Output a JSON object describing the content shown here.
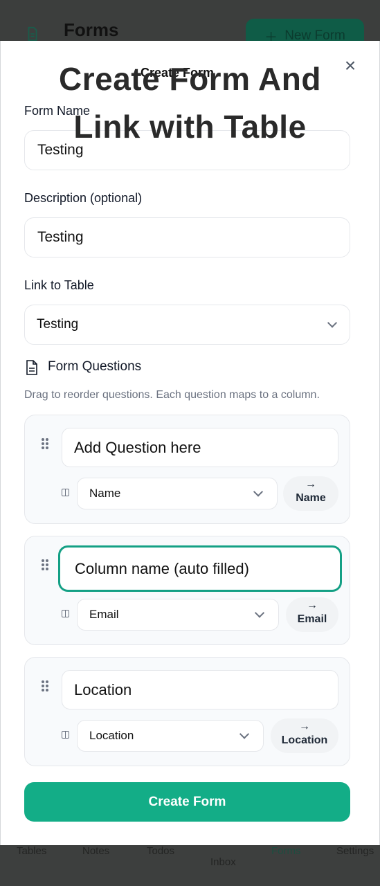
{
  "background": {
    "page_title": "Forms",
    "new_form_label": "New Form",
    "nav": [
      "Tables",
      "Notes",
      "Todos",
      "Inbox",
      "Forms",
      "Settings"
    ]
  },
  "overlay_caption": {
    "line1": "Create Form And",
    "line2": "Link with Table"
  },
  "dialog": {
    "title": "Create Form",
    "close_icon": "close-icon",
    "form_name_label": "Form Name",
    "form_name_value": "Testing",
    "description_label": "Description (optional)",
    "description_value": "Testing",
    "link_table_label": "Link to Table",
    "link_table_value": "Testing",
    "questions_title": "Form Questions",
    "questions_hint": "Drag to reorder questions. Each question maps to a column.",
    "questions": [
      {
        "text": "Add Question here",
        "column": "Name",
        "mapped_arrow": "→",
        "mapped_to": "Name"
      },
      {
        "text": "Column name (auto filled)",
        "column": "Email",
        "mapped_arrow": "→",
        "mapped_to": "Email"
      },
      {
        "text": "Location",
        "column": "Location",
        "mapped_arrow": "→",
        "mapped_to": "Location"
      }
    ],
    "submit_label": "Create Form"
  },
  "colors": {
    "accent": "#13ad87",
    "focus_border": "#14a085"
  }
}
